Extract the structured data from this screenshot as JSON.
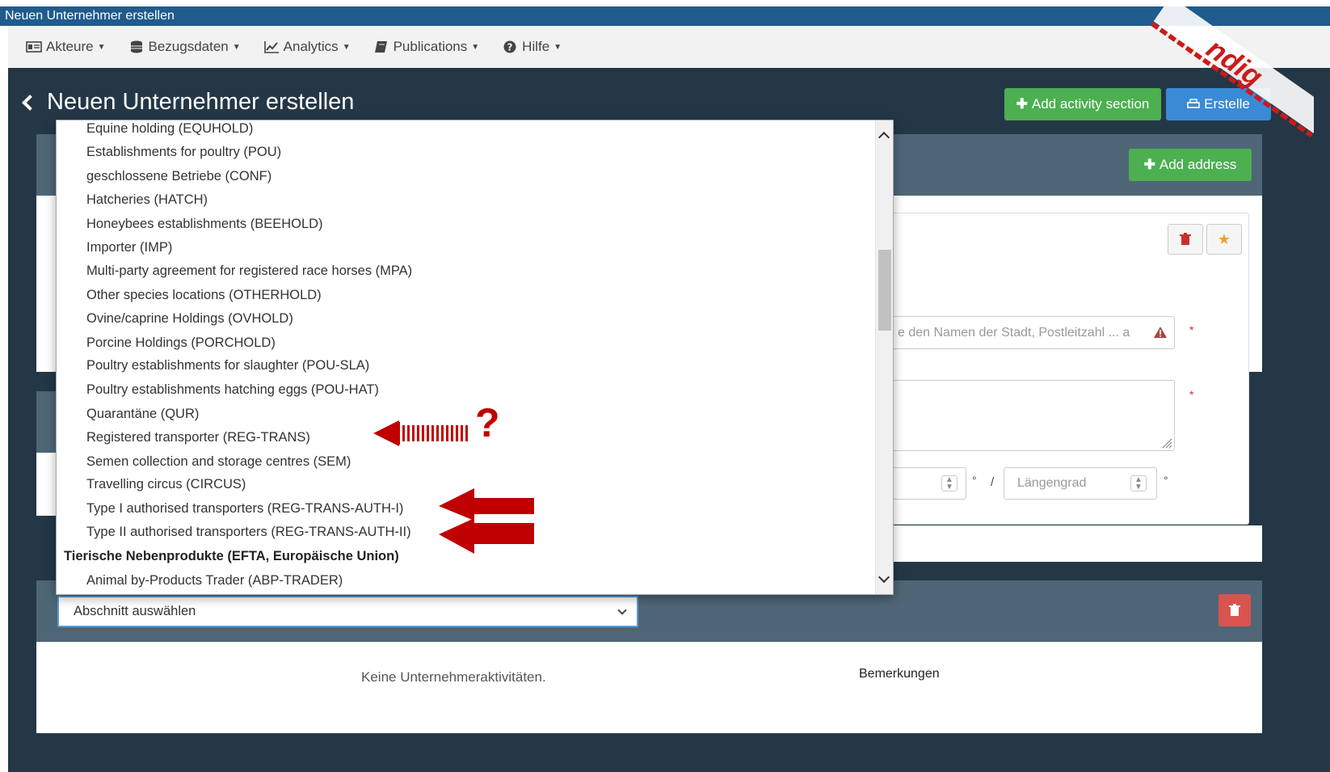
{
  "window": {
    "title": "Neuen Unternehmer erstellen"
  },
  "nav": {
    "items": [
      {
        "label": "Akteure",
        "icon": "id-card-icon"
      },
      {
        "label": "Bezugsdaten",
        "icon": "database-icon"
      },
      {
        "label": "Analytics",
        "icon": "line-chart-icon"
      },
      {
        "label": "Publications",
        "icon": "book-icon"
      },
      {
        "label": "Hilfe",
        "icon": "question-circle-icon"
      }
    ]
  },
  "page": {
    "title": "Neuen Unternehmer erstellen",
    "add_activity_label": "Add activity section",
    "create_label": "Erstelle",
    "add_address_label": "Add address"
  },
  "address": {
    "city_placeholder": "e den Namen der Stadt, Postleitzahl ... a",
    "longitude_placeholder": "Längengrad",
    "degree_symbol": "°",
    "separator": "/",
    "required_mark": "*"
  },
  "dropdown": {
    "options": [
      {
        "label": "Equine holding (EQUHOLD)",
        "group": false
      },
      {
        "label": "Establishments for poultry (POU)",
        "group": false
      },
      {
        "label": "geschlossene Betriebe (CONF)",
        "group": false
      },
      {
        "label": "Hatcheries (HATCH)",
        "group": false
      },
      {
        "label": "Honeybees establishments (BEEHOLD)",
        "group": false
      },
      {
        "label": "Importer (IMP)",
        "group": false
      },
      {
        "label": "Multi-party agreement for registered race horses (MPA)",
        "group": false
      },
      {
        "label": "Other species locations (OTHERHOLD)",
        "group": false
      },
      {
        "label": "Ovine/caprine Holdings (OVHOLD)",
        "group": false
      },
      {
        "label": "Porcine Holdings (PORCHOLD)",
        "group": false
      },
      {
        "label": "Poultry establishments for slaughter (POU-SLA)",
        "group": false
      },
      {
        "label": "Poultry establishments hatching eggs (POU-HAT)",
        "group": false
      },
      {
        "label": "Quarantäne (QUR)",
        "group": false
      },
      {
        "label": "Registered transporter (REG-TRANS)",
        "group": false
      },
      {
        "label": "Semen collection and storage centres (SEM)",
        "group": false
      },
      {
        "label": "Travelling circus (CIRCUS)",
        "group": false
      },
      {
        "label": "Type I authorised transporters (REG-TRANS-AUTH-I)",
        "group": false
      },
      {
        "label": "Type II authorised transporters (REG-TRANS-AUTH-II)",
        "group": false
      },
      {
        "label": "Tierische Nebenprodukte (EFTA, Europäische Union)",
        "group": true
      },
      {
        "label": "Animal by-Products Trader (ABP-TRADER)",
        "group": false
      }
    ]
  },
  "annotation": {
    "question_mark": "?"
  },
  "section": {
    "select_label": "Abschnitt auswählen",
    "empty_text": "Keine Unternehmeraktivitäten.",
    "remarks_label": "Bemerkungen"
  },
  "colors": {
    "title_bar": "#1f5b8c",
    "nav_bg": "#f2f2f2",
    "main_bg": "#243746",
    "accent_green": "#4caf50",
    "accent_blue": "#3a8ad6",
    "danger_red": "#d9534f",
    "annotation_red": "#c00000"
  }
}
